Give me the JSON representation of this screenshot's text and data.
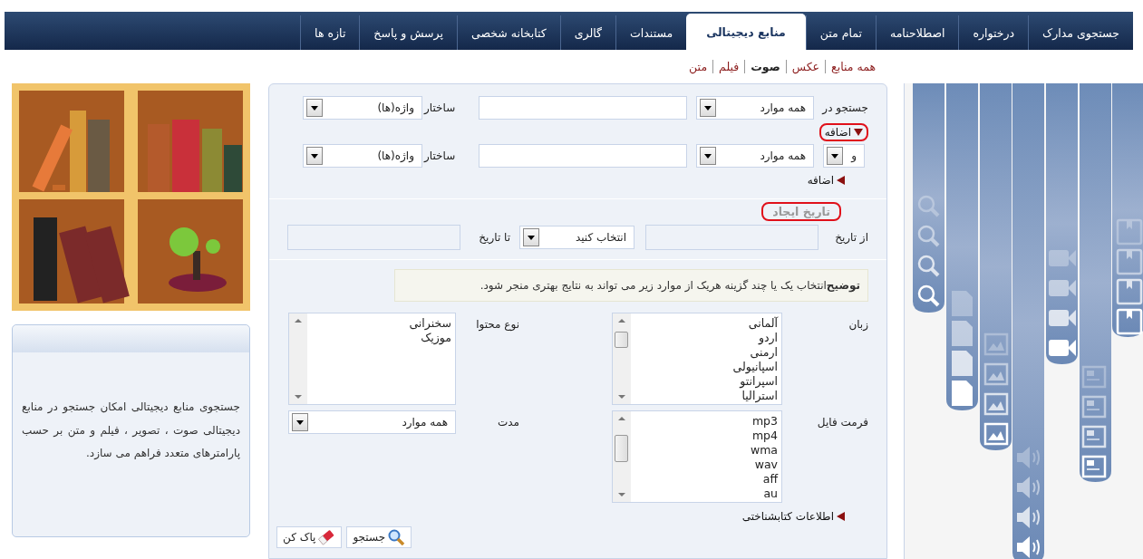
{
  "nav": {
    "tabs": [
      {
        "label": "جستجوی مدارک",
        "selected": false
      },
      {
        "label": "درختواره",
        "selected": false
      },
      {
        "label": "اصطلاحنامه",
        "selected": false
      },
      {
        "label": "تمام متن",
        "selected": false
      },
      {
        "label": "منابع دیجیتالی",
        "selected": true
      },
      {
        "label": "مستندات",
        "selected": false
      },
      {
        "label": "گالری",
        "selected": false
      },
      {
        "label": "کتابخانه شخصی",
        "selected": false
      },
      {
        "label": "پرسش و پاسخ",
        "selected": false
      },
      {
        "label": "تازه ها",
        "selected": false
      }
    ]
  },
  "media_links": [
    {
      "label": "همه منابع",
      "selected": false
    },
    {
      "label": "عکس",
      "selected": false
    },
    {
      "label": "صوت",
      "selected": true
    },
    {
      "label": "فیلم",
      "selected": false
    },
    {
      "label": "متن",
      "selected": false
    }
  ],
  "search": {
    "rows": [
      {
        "label": "جستجو در",
        "field": "همه موارد",
        "structure_label": "ساختار",
        "terms": "واژه(ها)",
        "add": {
          "label": "اضافه",
          "expanded": true,
          "highlighted": true
        }
      },
      {
        "operator": "و",
        "field": "همه موارد",
        "structure_label": "ساختار",
        "terms": "واژه(ها)",
        "add": {
          "label": "اضافه",
          "expanded": false,
          "highlighted": false
        }
      }
    ]
  },
  "date": {
    "heading": "تاریخ ایجاد",
    "highlighted": true,
    "from_label": "از تاریخ",
    "unit": "انتخاب کنید",
    "to_label": "تا تاریخ"
  },
  "note": "**توضیح**انتخاب یک یا چند گزینه هریک از موارد زیر می تواند به نتایج بهتری منجر شود.",
  "filters": [
    {
      "kind": "listbox",
      "label": "زبان",
      "options": [
        "آلمانی",
        "اردو",
        "ارمنی",
        "اسپانیولی",
        "اسپرانتو",
        "استرالیا"
      ]
    },
    {
      "kind": "listbox",
      "label": "نوع محتوا",
      "options": [
        "سخنرانی",
        "موزیک"
      ]
    },
    {
      "kind": "listbox",
      "label": "فرمت فایل",
      "options": [
        "mp3",
        "mp4",
        "wma",
        "wav",
        "aff",
        "au"
      ]
    },
    {
      "kind": "select",
      "label": "مدت",
      "value": "همه موارد"
    }
  ],
  "bibliographic": {
    "label": "اطلاعات کتابشناختی",
    "expanded": false
  },
  "buttons": [
    {
      "kind": "search",
      "label": "جستجو"
    },
    {
      "kind": "clear",
      "label": "پاک کن"
    }
  ],
  "sidebar": {
    "description": "جستجوی منابع دیجیتالی امکان جستجو در منابع دیجیتالی صوت ، تصویر ، فیلم و متن بر حسب پارامترهای متعدد فراهم می سازد."
  }
}
